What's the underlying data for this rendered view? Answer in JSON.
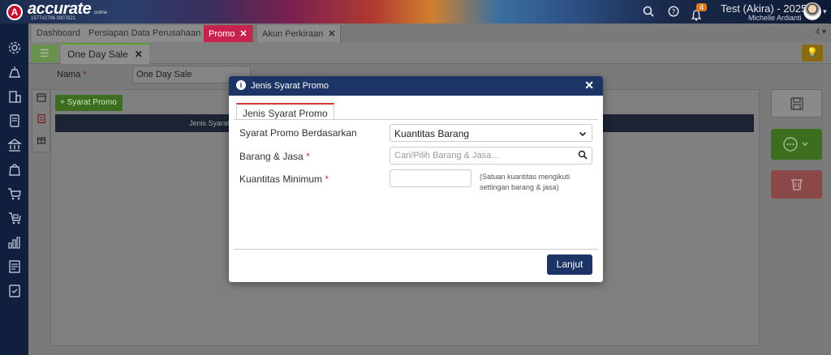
{
  "app": {
    "logo_text": "accurate",
    "logo_sub": "online",
    "logo_id": "1577#2796 0907821",
    "notification_count": "4",
    "user_title": "Test (Akira) - 2025",
    "user_name": "Michelle Ardianti"
  },
  "tabs": [
    {
      "label": "Dashboard"
    },
    {
      "label": "Persiapan Data Perusahaan"
    },
    {
      "label": "Promo",
      "close": "✕"
    },
    {
      "label": "Akun Perkiraan",
      "close": "✕"
    }
  ],
  "tab_counter": "4 ▾",
  "subtab": {
    "label": "One Day Sale",
    "close": "✕"
  },
  "form": {
    "nama_label": "Nama",
    "nama_required": "*",
    "nama_value": "One Day Sale",
    "add_button": "+ Syarat Promo",
    "grid_header": "Jenis Syarat"
  },
  "modal": {
    "title": "Jenis Syarat Promo",
    "close": "✕",
    "tab_label": "Jenis Syarat Promo",
    "fields": {
      "basis_label": "Syarat Promo Berdasarkan",
      "basis_value": "Kuantitas Barang",
      "item_label": "Barang & Jasa",
      "item_placeholder": "Cari/Pilih Barang & Jasa...",
      "qty_label": "Kuantitas Minimum",
      "qty_note": "(Satuan kuantitas mengikuti settingan barang & jasa)",
      "required_mark": "*"
    },
    "continue_button": "Lanjut"
  }
}
